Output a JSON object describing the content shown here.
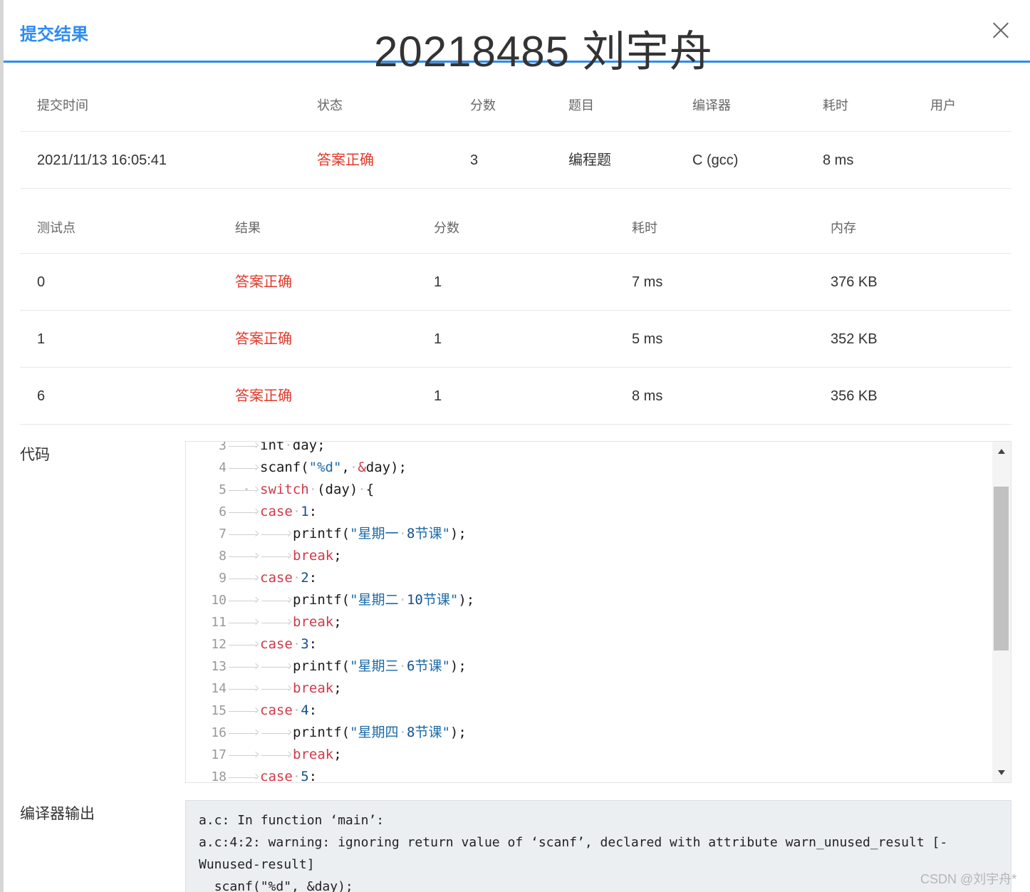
{
  "dialog": {
    "title": "提交结果",
    "overlay_title": "20218485 刘宇舟",
    "close_label": "×"
  },
  "summary": {
    "headers": [
      "提交时间",
      "状态",
      "分数",
      "题目",
      "编译器",
      "耗时",
      "用户"
    ],
    "row": {
      "time": "2021/11/13 16:05:41",
      "status": "答案正确",
      "score": "3",
      "problem": "编程题",
      "compiler": "C (gcc)",
      "elapsed": "8 ms",
      "user": ""
    }
  },
  "cases": {
    "headers": [
      "测试点",
      "结果",
      "分数",
      "耗时",
      "内存"
    ],
    "rows": [
      {
        "id": "0",
        "result": "答案正确",
        "score": "1",
        "time": "7 ms",
        "memory": "376 KB"
      },
      {
        "id": "1",
        "result": "答案正确",
        "score": "1",
        "time": "5 ms",
        "memory": "352 KB"
      },
      {
        "id": "6",
        "result": "答案正确",
        "score": "1",
        "time": "8 ms",
        "memory": "356 KB"
      }
    ]
  },
  "code_section": {
    "label": "代码",
    "lines": [
      {
        "n": "3",
        "indent": 1,
        "tokens": [
          [
            "t",
            "int"
          ],
          [
            "sp",
            " "
          ],
          [
            "t",
            "day;"
          ]
        ]
      },
      {
        "n": "4",
        "indent": 1,
        "tokens": [
          [
            "t",
            "scanf("
          ],
          [
            "str",
            "\"%d\""
          ],
          [
            "t",
            ","
          ],
          [
            "sp",
            " "
          ],
          [
            "amp",
            "&"
          ],
          [
            "t",
            "day);"
          ]
        ]
      },
      {
        "n": "5",
        "indent": 1,
        "fold": "▾",
        "tokens": [
          [
            "kw",
            "switch"
          ],
          [
            "sp",
            " "
          ],
          [
            "t",
            "(day)"
          ],
          [
            "sp",
            " "
          ],
          [
            "t",
            "{"
          ]
        ]
      },
      {
        "n": "6",
        "indent": 1,
        "tokens": [
          [
            "kw",
            "case"
          ],
          [
            "sp",
            " "
          ],
          [
            "num",
            "1"
          ],
          [
            "t",
            ":"
          ]
        ]
      },
      {
        "n": "7",
        "indent": 2,
        "tokens": [
          [
            "t",
            "printf("
          ],
          [
            "str",
            "\"星期一"
          ],
          [
            "sp",
            " "
          ],
          [
            "num",
            "8"
          ],
          [
            "str",
            "节课\""
          ],
          [
            "t",
            ");"
          ]
        ]
      },
      {
        "n": "8",
        "indent": 2,
        "tokens": [
          [
            "kw",
            "break"
          ],
          [
            "t",
            ";"
          ]
        ]
      },
      {
        "n": "9",
        "indent": 1,
        "tokens": [
          [
            "kw",
            "case"
          ],
          [
            "sp",
            " "
          ],
          [
            "num",
            "2"
          ],
          [
            "t",
            ":"
          ]
        ]
      },
      {
        "n": "10",
        "indent": 2,
        "tokens": [
          [
            "t",
            "printf("
          ],
          [
            "str",
            "\"星期二"
          ],
          [
            "sp",
            " "
          ],
          [
            "num",
            "10"
          ],
          [
            "str",
            "节课\""
          ],
          [
            "t",
            ");"
          ]
        ]
      },
      {
        "n": "11",
        "indent": 2,
        "tokens": [
          [
            "kw",
            "break"
          ],
          [
            "t",
            ";"
          ]
        ]
      },
      {
        "n": "12",
        "indent": 1,
        "tokens": [
          [
            "kw",
            "case"
          ],
          [
            "sp",
            " "
          ],
          [
            "num",
            "3"
          ],
          [
            "t",
            ":"
          ]
        ]
      },
      {
        "n": "13",
        "indent": 2,
        "tokens": [
          [
            "t",
            "printf("
          ],
          [
            "str",
            "\"星期三"
          ],
          [
            "sp",
            " "
          ],
          [
            "num",
            "6"
          ],
          [
            "str",
            "节课\""
          ],
          [
            "t",
            ");"
          ]
        ]
      },
      {
        "n": "14",
        "indent": 2,
        "tokens": [
          [
            "kw",
            "break"
          ],
          [
            "t",
            ";"
          ]
        ]
      },
      {
        "n": "15",
        "indent": 1,
        "tokens": [
          [
            "kw",
            "case"
          ],
          [
            "sp",
            " "
          ],
          [
            "num",
            "4"
          ],
          [
            "t",
            ":"
          ]
        ]
      },
      {
        "n": "16",
        "indent": 2,
        "tokens": [
          [
            "t",
            "printf("
          ],
          [
            "str",
            "\"星期四"
          ],
          [
            "sp",
            " "
          ],
          [
            "num",
            "8"
          ],
          [
            "str",
            "节课\""
          ],
          [
            "t",
            ");"
          ]
        ]
      },
      {
        "n": "17",
        "indent": 2,
        "tokens": [
          [
            "kw",
            "break"
          ],
          [
            "t",
            ";"
          ]
        ]
      },
      {
        "n": "18",
        "indent": 1,
        "tokens": [
          [
            "kw",
            "case"
          ],
          [
            "sp",
            " "
          ],
          [
            "num",
            "5"
          ],
          [
            "t",
            ":"
          ]
        ]
      }
    ]
  },
  "compiler_output": {
    "label": "编译器输出",
    "text": "a.c: In function ‘main’:\na.c:4:2: warning: ignoring return value of ‘scanf’, declared with attribute warn_unused_result [-Wunused-result]\n  scanf(\"%d\", &day);"
  },
  "watermark": "CSDN @刘宇舟*",
  "colors": {
    "accent": "#2d8cf0",
    "accepted": "#e0392b",
    "keyword": "#d03a48",
    "string": "#1a6aa8"
  }
}
